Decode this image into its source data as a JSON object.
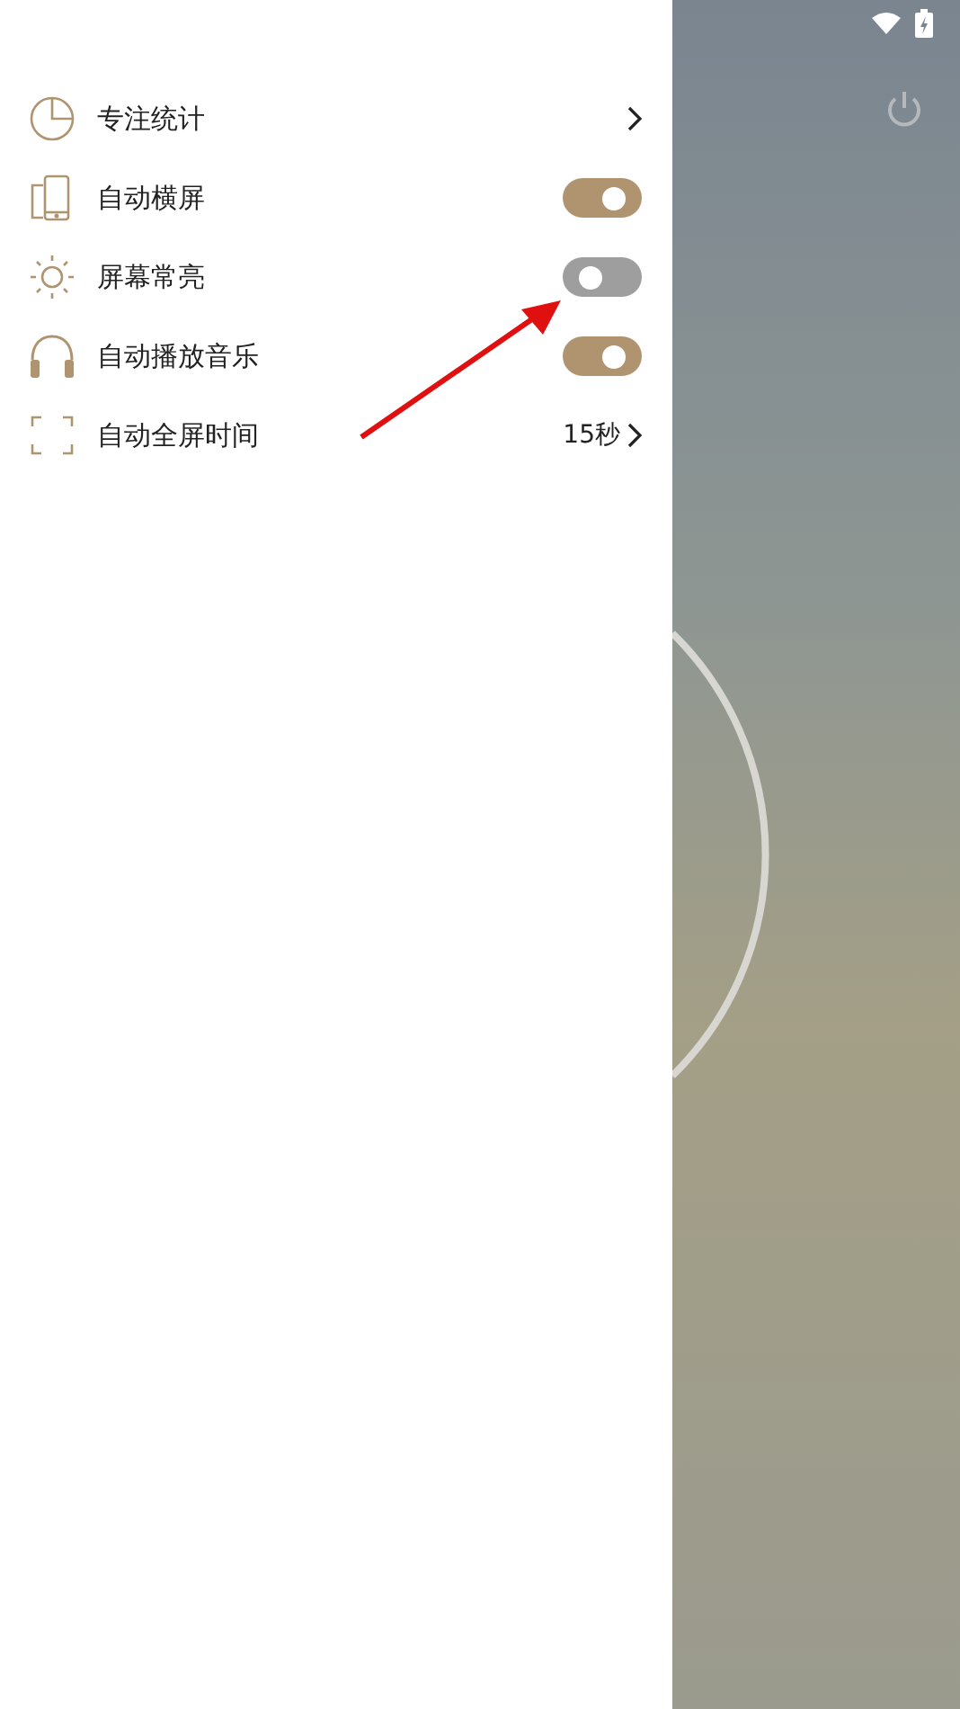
{
  "menu": {
    "items": [
      {
        "kind": "link",
        "label": "专注统计"
      },
      {
        "kind": "toggle",
        "label": "自动横屏",
        "on": true
      },
      {
        "kind": "toggle",
        "label": "屏幕常亮",
        "on": false
      },
      {
        "kind": "toggle",
        "label": "自动播放音乐",
        "on": true
      },
      {
        "kind": "link",
        "label": "自动全屏时间",
        "value": "15秒"
      }
    ]
  }
}
